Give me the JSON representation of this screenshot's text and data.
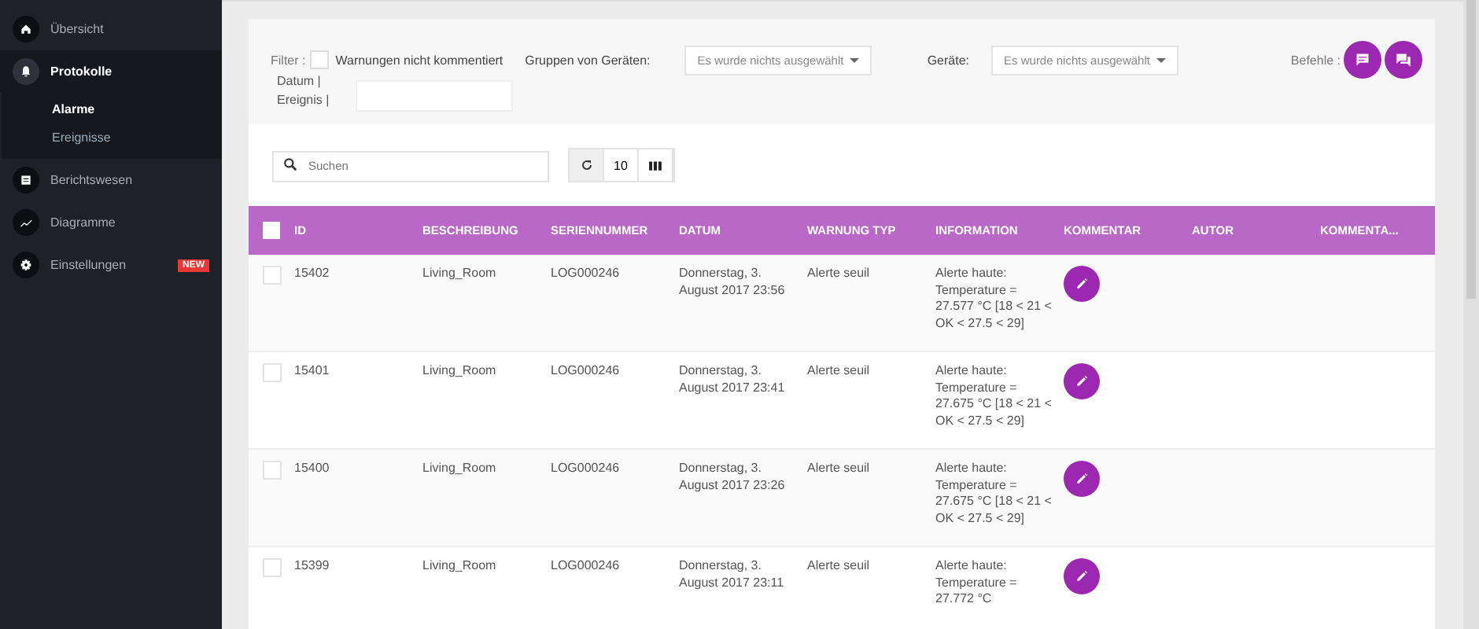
{
  "sidebar": {
    "items": [
      {
        "label": "Übersicht",
        "selected": false,
        "expanded": false
      },
      {
        "label": "Protokolle",
        "selected": true,
        "expanded": true,
        "children": [
          {
            "label": "Alarme",
            "selected": true
          },
          {
            "label": "Ereignisse",
            "selected": false
          }
        ]
      },
      {
        "label": "Berichtswesen",
        "selected": false,
        "expanded": false
      },
      {
        "label": "Diagramme",
        "selected": false,
        "expanded": false
      },
      {
        "label": "Einstellungen",
        "selected": false,
        "expanded": false,
        "badge": "NEW"
      }
    ]
  },
  "filter": {
    "label": "Filter :",
    "checkbox": {
      "label": "Warnungen nicht kommentiert",
      "checked": false
    },
    "groups_label": "Gruppen von Geräten:",
    "groups_value": "Es wurde nichts ausgewählt",
    "devices_label": "Geräte:",
    "devices_value": "Es wurde nichts ausgewählt",
    "commands_label": "Befehle :",
    "date_label": "Datum | Ereignis |"
  },
  "toolbar": {
    "search_placeholder": "Suchen",
    "page_size": "10"
  },
  "table": {
    "select_all_checked": false,
    "columns": [
      "ID",
      "BESCHREIBUNG",
      "SERIENNUMMER",
      "DATUM",
      "WARNUNG TYP",
      "INFORMATION",
      "KOMMENTAR",
      "AUTOR",
      "KOMMENTA..."
    ],
    "rows": [
      {
        "checked": false,
        "cells": [
          "15402",
          "Living_Room",
          "LOG000246",
          "Donnerstag, 3. August 2017 23:56",
          "Alerte seuil",
          "Alerte haute: Temperature = 27.577 °C [18 < 21 < OK < 27.5 < 29]"
        ]
      },
      {
        "checked": false,
        "cells": [
          "15401",
          "Living_Room",
          "LOG000246",
          "Donnerstag, 3. August 2017 23:41",
          "Alerte seuil",
          "Alerte haute: Temperature = 27.675 °C [18 < 21 < OK < 27.5 < 29]"
        ]
      },
      {
        "checked": false,
        "cells": [
          "15400",
          "Living_Room",
          "LOG000246",
          "Donnerstag, 3. August 2017 23:26",
          "Alerte seuil",
          "Alerte haute: Temperature = 27.675 °C [18 < 21 < OK < 27.5 < 29]"
        ]
      },
      {
        "checked": false,
        "cells": [
          "15399",
          "Living_Room",
          "LOG000246",
          "Donnerstag, 3. August 2017 23:11",
          "Alerte seuil",
          "Alerte haute: Temperature = 27.772 °C"
        ]
      }
    ]
  }
}
